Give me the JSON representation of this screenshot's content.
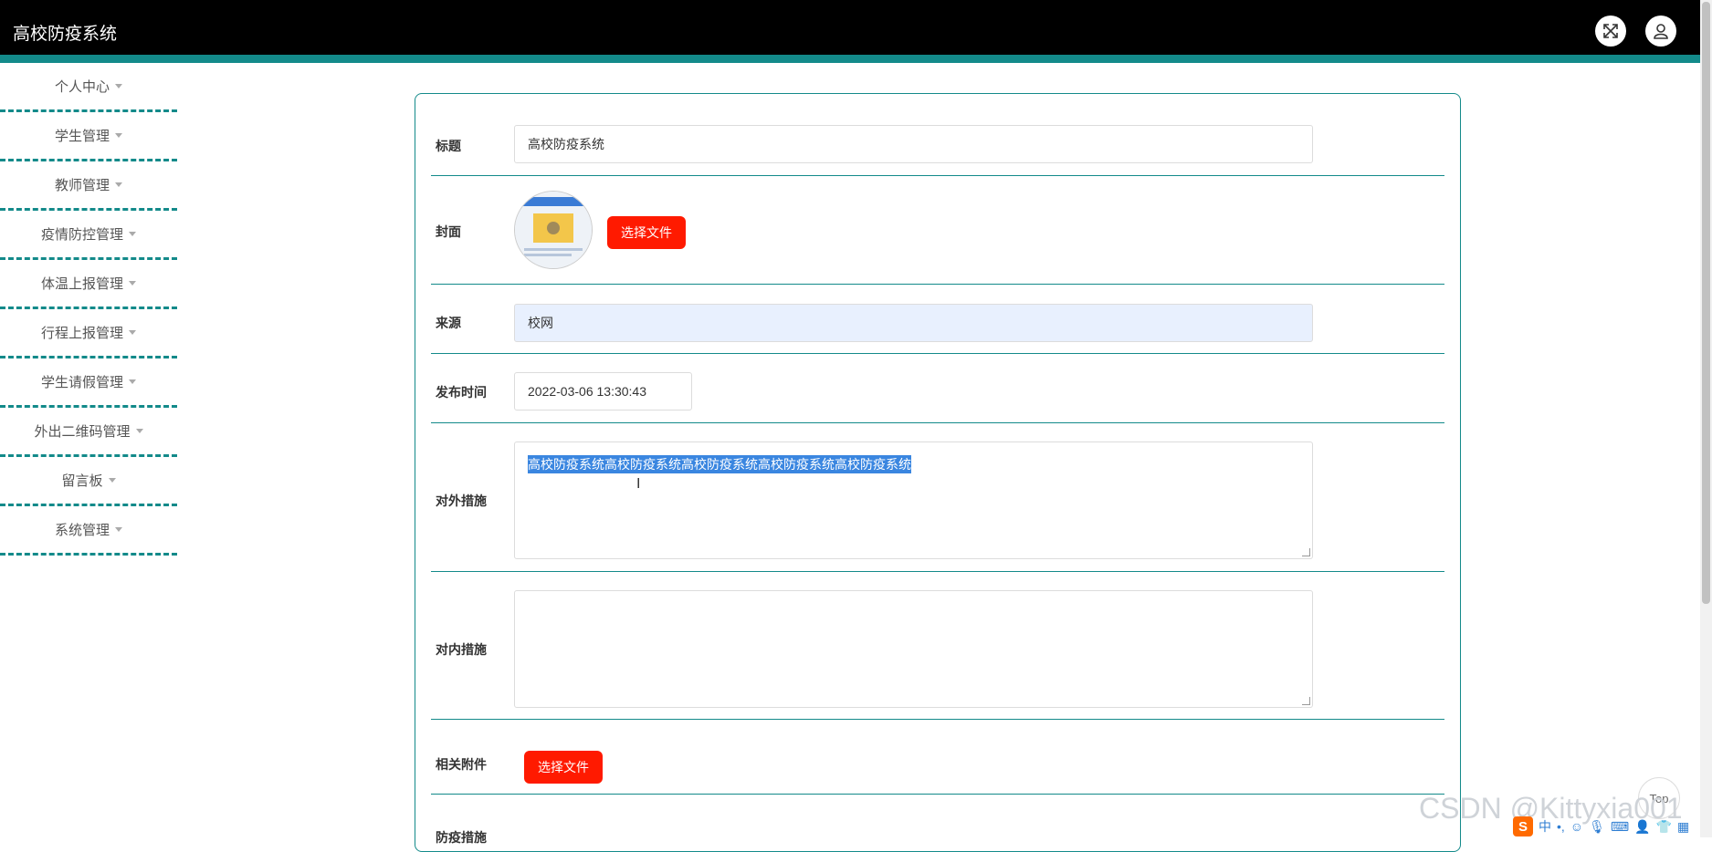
{
  "app": {
    "title": "高校防疫系统"
  },
  "header": {
    "fullscreen_icon": "expand-arrows-icon",
    "user_icon": "user-avatar-icon"
  },
  "sidebar": {
    "items": [
      {
        "label": "个人中心"
      },
      {
        "label": "学生管理"
      },
      {
        "label": "教师管理"
      },
      {
        "label": "疫情防控管理"
      },
      {
        "label": "体温上报管理"
      },
      {
        "label": "行程上报管理"
      },
      {
        "label": "学生请假管理"
      },
      {
        "label": "外出二维码管理"
      },
      {
        "label": "留言板"
      },
      {
        "label": "系统管理"
      }
    ]
  },
  "form": {
    "title": {
      "label": "标题",
      "value": "高校防疫系统"
    },
    "cover": {
      "label": "封面",
      "button": "选择文件"
    },
    "source": {
      "label": "来源",
      "value": "校网"
    },
    "publish_time": {
      "label": "发布时间",
      "value": "2022-03-06 13:30:43"
    },
    "external_measures": {
      "label": "对外措施",
      "value": "高校防疫系统高校防疫系统高校防疫系统高校防疫系统高校防疫系统"
    },
    "internal_measures": {
      "label": "对内措施",
      "value": ""
    },
    "attachment": {
      "label": "相关附件",
      "button": "选择文件"
    },
    "prevention_measures": {
      "label": "防疫措施"
    }
  },
  "overlay": {
    "top_button": "Top",
    "watermark": "CSDN @Kittyxia001",
    "ime_logo": "S",
    "ime_mode": "中"
  },
  "colors": {
    "accent": "#138a8a",
    "danger_button": "#ff1a00",
    "topbar": "#000000"
  }
}
